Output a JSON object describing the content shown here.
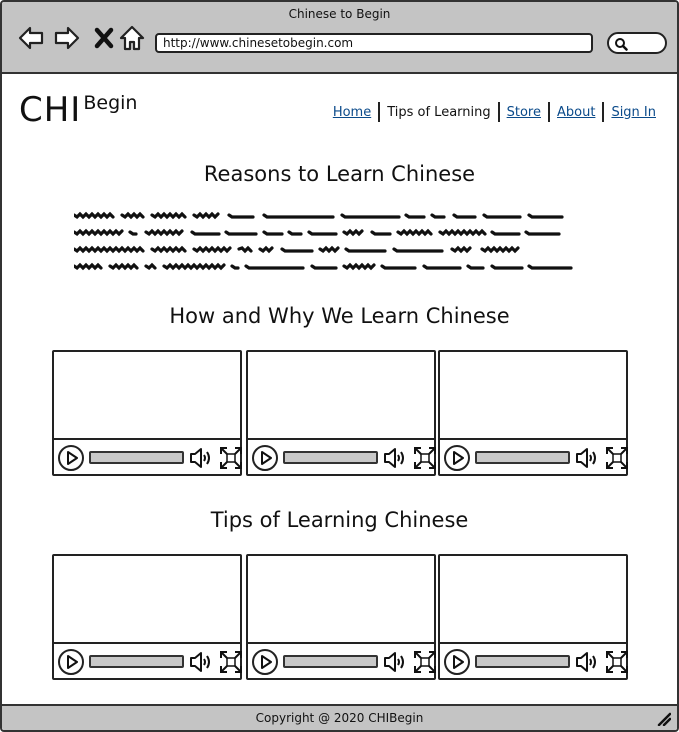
{
  "browser": {
    "window_title": "Chinese to Begin",
    "url": "http://www.chinesetobegin.com",
    "icons": [
      "back-arrow-icon",
      "forward-arrow-icon",
      "close-x-icon",
      "home-icon",
      "search-icon"
    ]
  },
  "header": {
    "logo_main": "CHI",
    "logo_sub": "Begin",
    "nav": [
      {
        "label": "Home",
        "active": false
      },
      {
        "label": "Tips of Learning",
        "active": true
      },
      {
        "label": "Store",
        "active": false
      },
      {
        "label": "About",
        "active": false
      },
      {
        "label": "Sign In",
        "active": false
      }
    ]
  },
  "sections": {
    "reasons_title": "Reasons to Learn Chinese",
    "how_why_title": "How and Why We Learn Chinese",
    "tips_title": "Tips of Learning Chinese"
  },
  "videos": {
    "how_why_count": 3,
    "tips_count": 3,
    "control_icons": [
      "play-icon",
      "volume-icon",
      "fullscreen-icon"
    ]
  },
  "footer": {
    "copyright": "Copyright @ 2020 CHIBegin"
  },
  "colors": {
    "chrome_gray": "#c4c4c4",
    "link_blue": "#0a4a8a",
    "progress_gray": "#c9c9c9"
  }
}
